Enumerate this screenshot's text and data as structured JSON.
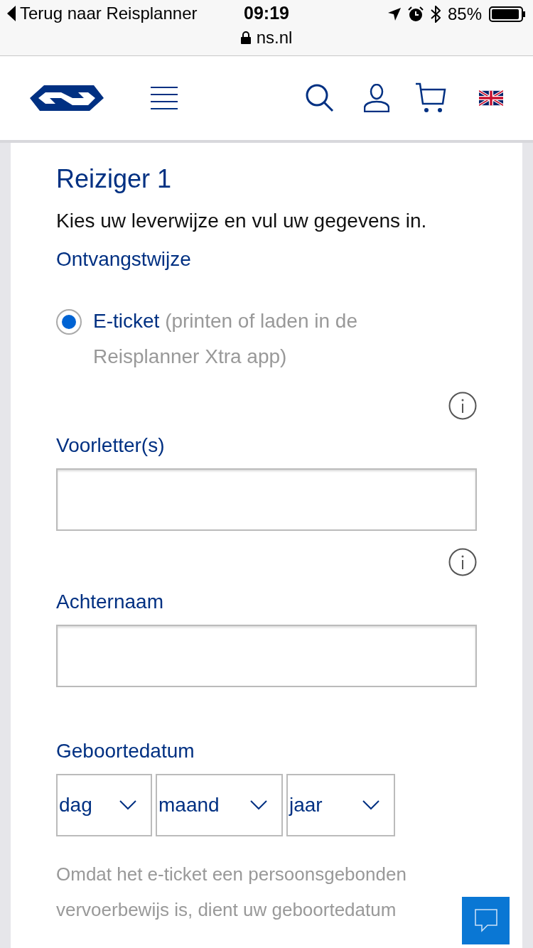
{
  "status_bar": {
    "back": "Terug naar Reisplanner",
    "time": "09:19",
    "url": "ns.nl",
    "battery": "85%"
  },
  "section": {
    "title": "Reiziger 1",
    "intro": "Kies uw leverwijze en vul uw gegevens in.",
    "delivery_label": "Ontvangstwijze",
    "delivery_options": [
      {
        "label": "E-ticket",
        "note": "(printen of laden in de Reisplanner Xtra app)",
        "selected": true
      }
    ],
    "fields": [
      {
        "kind": "text",
        "label": "Voorletter(s)",
        "info": true
      },
      {
        "kind": "text",
        "label": "Achternaam",
        "info": true
      },
      {
        "kind": "date",
        "label": "Geboortedatum",
        "selects": [
          "dag",
          "maand",
          "jaar"
        ]
      }
    ],
    "help": "Omdat het e-ticket een persoonsgebonden vervoerbewijs is, dient uw geboortedatum"
  }
}
